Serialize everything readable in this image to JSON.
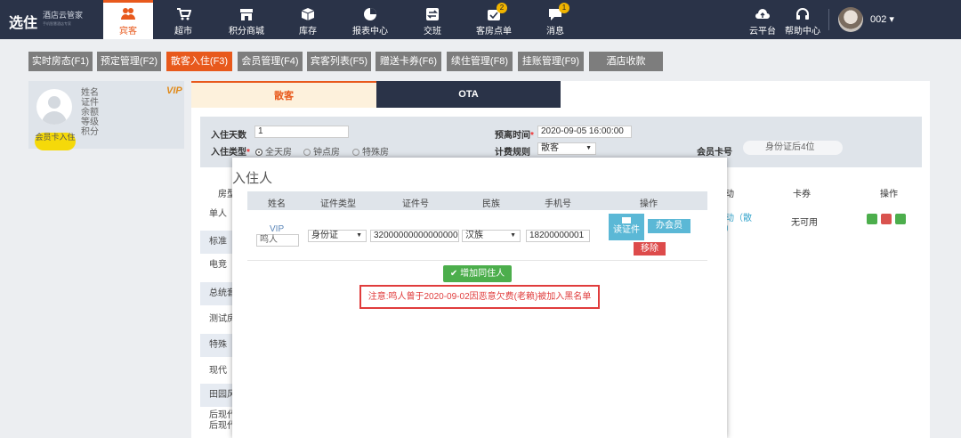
{
  "brand": {
    "name": "选住",
    "sub": "酒店云管家",
    "tagline": "手机智慧酒店专家"
  },
  "nav": [
    {
      "label": "宾客",
      "icon": "guests-icon",
      "active": true
    },
    {
      "label": "超市",
      "icon": "cart-icon"
    },
    {
      "label": "积分商城",
      "icon": "store-icon"
    },
    {
      "label": "库存",
      "icon": "box-icon"
    },
    {
      "label": "报表中心",
      "icon": "pie-chart-icon"
    },
    {
      "label": "交班",
      "icon": "shift-icon"
    },
    {
      "label": "客房点单",
      "icon": "order-icon",
      "badge": "2"
    },
    {
      "label": "消息",
      "icon": "message-icon",
      "badge": "1"
    }
  ],
  "right_nav": [
    {
      "label": "云平台",
      "icon": "cloud-upload-icon"
    },
    {
      "label": "帮助中心",
      "icon": "headset-icon"
    }
  ],
  "user": {
    "name": "002 ▾"
  },
  "tabs": [
    "实时房态(F1)",
    "预定管理(F2)",
    "散客入住(F3)",
    "会员管理(F4)",
    "宾客列表(F5)",
    "赠送卡券(F6)",
    "续住管理(F8)",
    "挂账管理(F9)",
    "酒店收款"
  ],
  "active_tab": 2,
  "guest_panel": {
    "labels": [
      "姓名",
      "证件",
      "余额",
      "等级",
      "积分"
    ],
    "vip": "VIP",
    "card_button": "会员卡入住"
  },
  "sub_tabs": {
    "walkin": "散客",
    "ota": "OTA"
  },
  "form": {
    "days_label": "入住天数",
    "days_value": "1",
    "type_label": "入住类型",
    "types": [
      "全天房",
      "钟点房",
      "特殊房"
    ],
    "leave_label": "预离时间",
    "leave_value": "2020-09-05 16:00:00",
    "billing_label": "计费规则",
    "billing_value": "散客",
    "member_label": "会员卡号",
    "member_placeholder": "身份证后4位"
  },
  "room_table": {
    "col_room": "房型",
    "col_activity": "动",
    "col_coupon": "卡券",
    "col_ops": "操作",
    "rows": [
      "单人",
      "标准",
      "电竞",
      "总统套",
      "测试房",
      "特殊",
      "现代",
      "田园风",
      "后现代",
      "后现代"
    ],
    "first_row_activity": "动（散",
    "first_row_activity2": "）",
    "first_row_coupon": "无可用"
  },
  "dialog": {
    "title": "入住人",
    "headers": [
      "姓名",
      "证件类型",
      "证件号",
      "民族",
      "手机号",
      "操作"
    ],
    "guest": {
      "vip": "VIP",
      "name": "鸣人",
      "id_type": "身份证",
      "id_number": "320000000000000000",
      "ethnicity": "汉族",
      "phone": "18200000001"
    },
    "btn_read": "读证件",
    "btn_member": "办会员",
    "btn_remove": "移除",
    "btn_add": "✔ 增加同住人",
    "warning": "注意:鸣人曾于2020-09-02因恶意欠费(老赖)被加入黑名单"
  }
}
